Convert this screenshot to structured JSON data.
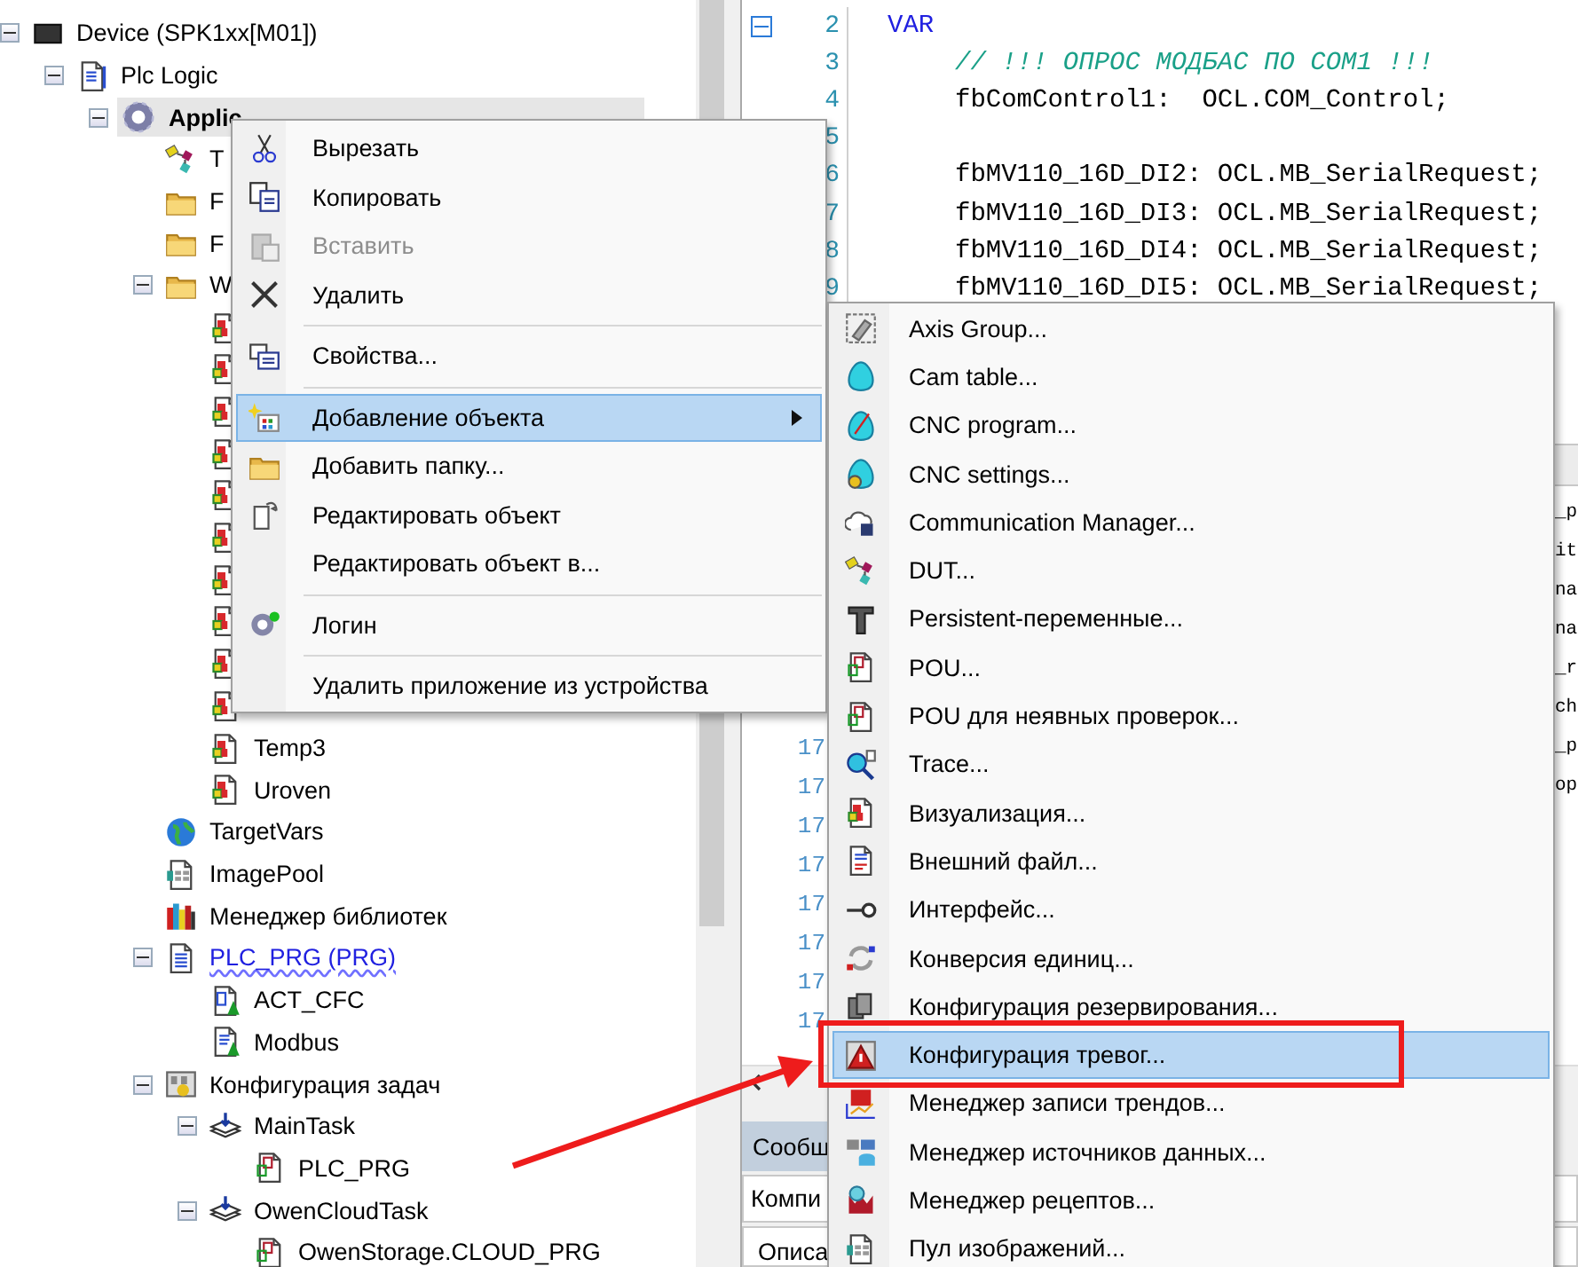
{
  "tree": [
    {
      "label": "Device (SPK1xx[M01])",
      "kind": "device",
      "selected": false,
      "expanded": true,
      "children": [
        {
          "label": "Plc Logic",
          "kind": "plc",
          "selected": false,
          "expanded": true,
          "children": [
            {
              "label": "Applic",
              "kind": "application",
              "selected": true,
              "expanded": true,
              "children": [
                {
                  "label": "T",
                  "kind": "dut",
                  "selected": false
                },
                {
                  "label": "F",
                  "kind": "folder",
                  "selected": false
                },
                {
                  "label": "F",
                  "kind": "folder",
                  "selected": false
                },
                {
                  "label": "W",
                  "kind": "folder",
                  "selected": false,
                  "expanded": true,
                  "children": [
                    {
                      "kind": "visu",
                      "selected": false
                    },
                    {
                      "kind": "visu",
                      "selected": false
                    },
                    {
                      "kind": "visu",
                      "selected": false
                    },
                    {
                      "kind": "visu",
                      "selected": false
                    },
                    {
                      "kind": "visu",
                      "selected": false
                    },
                    {
                      "kind": "visu",
                      "selected": false
                    },
                    {
                      "kind": "visu",
                      "selected": false
                    },
                    {
                      "kind": "visu",
                      "selected": false
                    },
                    {
                      "kind": "visu",
                      "selected": false
                    },
                    {
                      "kind": "visu",
                      "selected": false
                    },
                    {
                      "label": "Temp3",
                      "kind": "visu",
                      "selected": false
                    },
                    {
                      "label": "Uroven",
                      "kind": "visu",
                      "selected": false
                    }
                  ]
                },
                {
                  "label": "TargetVars",
                  "kind": "globe",
                  "selected": false
                },
                {
                  "label": "ImagePool",
                  "kind": "imagepool",
                  "selected": false
                },
                {
                  "label": "Менеджер библиотек",
                  "kind": "library",
                  "selected": false
                },
                {
                  "label": "PLC_PRG (PRG)",
                  "kind": "prg",
                  "selected": false,
                  "error": true,
                  "expanded": true,
                  "children": [
                    {
                      "label": "ACT_CFC",
                      "kind": "action_cfc",
                      "selected": false
                    },
                    {
                      "label": "Modbus",
                      "kind": "action_st",
                      "selected": false
                    }
                  ]
                },
                {
                  "label": "Конфигурация задач",
                  "kind": "taskconfig",
                  "selected": false,
                  "expanded": true,
                  "children": [
                    {
                      "label": "MainTask",
                      "kind": "task",
                      "selected": false,
                      "expanded": true,
                      "children": [
                        {
                          "label": "PLC_PRG",
                          "kind": "pou",
                          "selected": false
                        }
                      ]
                    },
                    {
                      "label": "OwenCloudTask",
                      "kind": "task",
                      "selected": false,
                      "expanded": true,
                      "children": [
                        {
                          "label": "OwenStorage.CLOUD_PRG",
                          "kind": "pou",
                          "selected": false
                        }
                      ]
                    }
                  ]
                }
              ]
            }
          ]
        }
      ]
    }
  ],
  "declaration_editor": {
    "lines": [
      {
        "number": "2",
        "kind": "keyword",
        "fold": true,
        "code": "VAR"
      },
      {
        "number": "3",
        "kind": "comment",
        "fold": false,
        "code": "// !!! ОПРОС МОДБАС ПО COM1 !!!"
      },
      {
        "number": "4",
        "kind": "code",
        "fold": false,
        "code": "fbComControl1:  OCL.COM_Control;"
      },
      {
        "number": "5",
        "fold": false
      },
      {
        "number": "6",
        "kind": "code",
        "fold": false,
        "code": "fbMV110_16D_DI2: OCL.MB_SerialRequest;"
      },
      {
        "number": "7",
        "kind": "code",
        "fold": false,
        "code": "fbMV110_16D_DI3: OCL.MB_SerialRequest;"
      },
      {
        "number": "8",
        "kind": "code",
        "fold": false,
        "code": "fbMV110_16D_DI4: OCL.MB_SerialRequest;"
      },
      {
        "number": "9",
        "kind": "code",
        "fold": false,
        "code": "fbMV110_16D_DI5: OCL.MB_SerialRequest;"
      }
    ]
  },
  "body_editor": {
    "lines": [
      {
        "code": "_p"
      },
      {
        "code": "it"
      },
      {
        "code": "na"
      },
      {
        "code": "na"
      },
      {
        "code": "_r"
      },
      {
        "code": "ch"
      },
      {
        "number": "17",
        "code": "_p"
      },
      {
        "number": "17",
        "code": "op"
      },
      {
        "number": "17"
      },
      {
        "number": "17"
      },
      {
        "number": "17"
      },
      {
        "number": "17"
      },
      {
        "number": "17"
      },
      {
        "number": "17"
      }
    ]
  },
  "messages": {
    "tabs": [
      {
        "label": "Сообщ",
        "selected": true
      }
    ],
    "filter": "Компи",
    "column": "Описа"
  },
  "context_menu": {
    "items": [
      {
        "label": "Вырезать",
        "kind": "cut",
        "disabled": false,
        "selected": false,
        "has_submenu": false
      },
      {
        "label": "Копировать",
        "kind": "copy",
        "disabled": false,
        "selected": false,
        "has_submenu": false
      },
      {
        "label": "Вставить",
        "kind": "paste",
        "disabled": true,
        "selected": false,
        "has_submenu": false
      },
      {
        "label": "Удалить",
        "kind": "delete",
        "disabled": false,
        "selected": false,
        "has_submenu": false
      },
      {
        "kind": "separator"
      },
      {
        "label": "Свойства...",
        "kind": "properties",
        "disabled": false,
        "selected": false,
        "has_submenu": false
      },
      {
        "kind": "separator"
      },
      {
        "label": "Добавление объекта",
        "kind": "add_object",
        "disabled": false,
        "selected": true,
        "has_submenu": true
      },
      {
        "label": "Добавить папку...",
        "kind": "folder",
        "disabled": false,
        "selected": false,
        "has_submenu": false
      },
      {
        "label": "Редактировать объект",
        "kind": "edit",
        "disabled": false,
        "selected": false,
        "has_submenu": false
      },
      {
        "label": "Редактировать объект в...",
        "kind": "none",
        "disabled": false,
        "selected": false,
        "has_submenu": false
      },
      {
        "kind": "separator"
      },
      {
        "label": "Логин",
        "kind": "login",
        "disabled": false,
        "selected": false,
        "has_submenu": false
      },
      {
        "kind": "separator"
      },
      {
        "label": "Удалить приложение из устройства",
        "kind": "none",
        "disabled": false,
        "selected": false,
        "has_submenu": false
      }
    ]
  },
  "submenu": {
    "items": [
      {
        "label": "Axis Group...",
        "kind": "axis",
        "selected": false,
        "annotated": false
      },
      {
        "label": "Cam table...",
        "kind": "cam",
        "selected": false,
        "annotated": false
      },
      {
        "label": "CNC program...",
        "kind": "cnc",
        "selected": false,
        "annotated": false
      },
      {
        "label": "CNC settings...",
        "kind": "cnc_settings",
        "selected": false,
        "annotated": false
      },
      {
        "label": "Communication Manager...",
        "kind": "comm",
        "selected": false,
        "annotated": false
      },
      {
        "label": "DUT...",
        "kind": "dut",
        "selected": false,
        "annotated": false
      },
      {
        "label": "Persistent-переменные...",
        "kind": "persistent",
        "selected": false,
        "annotated": false
      },
      {
        "label": "POU...",
        "kind": "pou",
        "selected": false,
        "annotated": false
      },
      {
        "label": "POU для неявных проверок...",
        "kind": "pou",
        "selected": false,
        "annotated": false
      },
      {
        "label": "Trace...",
        "kind": "trace",
        "selected": false,
        "annotated": false
      },
      {
        "label": "Визуализация...",
        "kind": "visu",
        "selected": false,
        "annotated": false
      },
      {
        "label": "Внешний файл...",
        "kind": "ext_file",
        "selected": false,
        "annotated": false
      },
      {
        "label": "Интерфейс...",
        "kind": "interface",
        "selected": false,
        "annotated": false
      },
      {
        "label": "Конверсия единиц...",
        "kind": "unit_conv",
        "selected": false,
        "annotated": false
      },
      {
        "label": "Конфигурация резервирования...",
        "kind": "redundancy",
        "selected": false,
        "annotated": false
      },
      {
        "label": "Конфигурация тревог...",
        "kind": "alarm",
        "selected": true,
        "annotated": true
      },
      {
        "label": "Менеджер записи трендов...",
        "kind": "trend",
        "selected": false,
        "annotated": false
      },
      {
        "label": "Менеджер источников данных...",
        "kind": "datasource",
        "selected": false,
        "annotated": false
      },
      {
        "label": "Менеджер рецептов...",
        "kind": "recipe",
        "selected": false,
        "annotated": false
      },
      {
        "label": "Пул изображений...",
        "kind": "imagepool",
        "selected": false,
        "annotated": false
      }
    ]
  }
}
